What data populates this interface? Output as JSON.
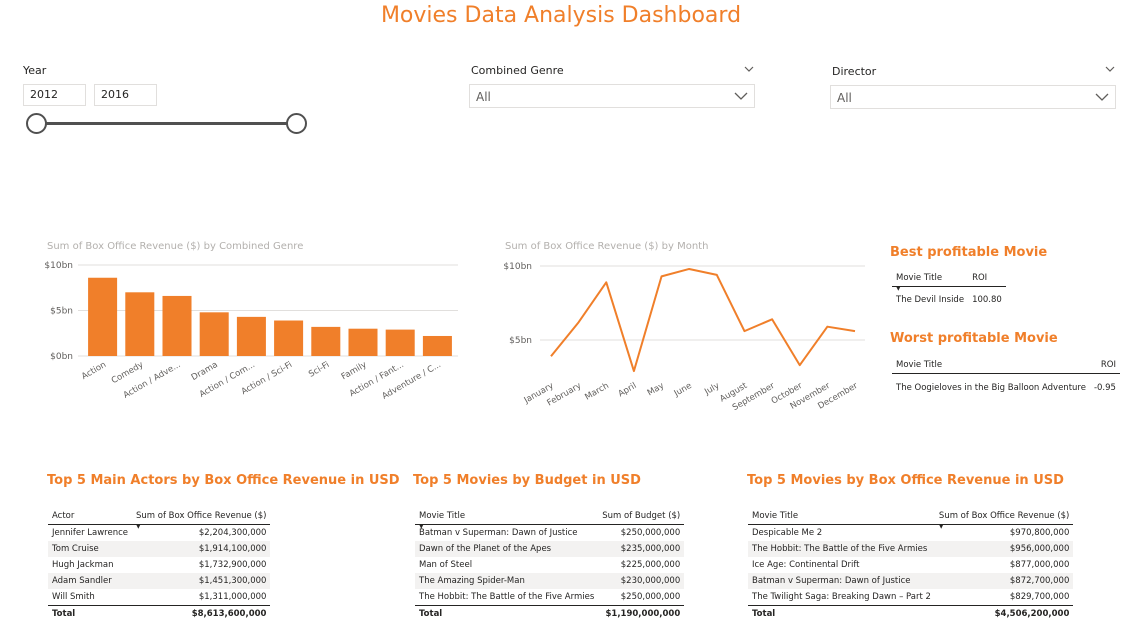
{
  "title": "Movies Data Analysis Dashboard",
  "filters": {
    "year": {
      "label": "Year",
      "start": "2012",
      "end": "2016"
    },
    "genre": {
      "label": "Combined Genre",
      "value": "All"
    },
    "director": {
      "label": "Director",
      "value": "All"
    }
  },
  "colors": {
    "accent": "#f07f2a",
    "grid": "#e1dfdd",
    "axis_text": "#605e5c",
    "title_gray": "#b3b0ad"
  },
  "genre_chart": {
    "title": "Sum of Box Office Revenue ($) by Combined Genre",
    "chart_data": {
      "type": "bar",
      "title": "Sum of Box Office Revenue ($) by Combined Genre",
      "categories": [
        "Action",
        "Comedy",
        "Action / Adve...",
        "Drama",
        "Action / Com...",
        "Action / Sci-Fi",
        "Sci-Fi",
        "Family",
        "Action / Fant...",
        "Adventure / C..."
      ],
      "values": [
        8.6,
        7.0,
        6.6,
        4.8,
        4.3,
        3.9,
        3.2,
        3.0,
        2.9,
        2.2
      ],
      "unit": "bn",
      "yticks": [
        "$0bn",
        "$5bn",
        "$10bn"
      ],
      "ylim": [
        0,
        10
      ],
      "grid": true
    }
  },
  "month_chart": {
    "title": "Sum of Box Office Revenue ($) by Month",
    "chart_data": {
      "type": "line",
      "title": "Sum of Box Office Revenue ($) by Month",
      "categories": [
        "January",
        "February",
        "March",
        "April",
        "May",
        "June",
        "July",
        "August",
        "September",
        "October",
        "November",
        "December"
      ],
      "values": [
        3.9,
        6.2,
        8.9,
        2.9,
        9.3,
        9.8,
        9.4,
        5.6,
        6.4,
        3.3,
        5.9,
        5.6
      ],
      "unit": "bn",
      "yticks": [
        "$5bn",
        "$10bn"
      ],
      "ylim": [
        2.2,
        10.0
      ],
      "grid": true
    }
  },
  "best_movie": {
    "title": "Best profitable Movie",
    "headers": [
      "Movie Title",
      "ROI"
    ],
    "row": [
      "The Devil Inside",
      "100.80"
    ]
  },
  "worst_movie": {
    "title": "Worst profitable Movie",
    "headers": [
      "Movie Title",
      "ROI"
    ],
    "row": [
      "The Oogieloves in the Big Balloon Adventure",
      "-0.95"
    ]
  },
  "actors": {
    "title": "Top 5 Main Actors by Box Office Revenue in USD",
    "headers": [
      "Actor",
      "Sum of Box Office Revenue ($)"
    ],
    "rows": [
      [
        "Jennifer Lawrence",
        "$2,204,300,000"
      ],
      [
        "Tom Cruise",
        "$1,914,100,000"
      ],
      [
        "Hugh Jackman",
        "$1,732,900,000"
      ],
      [
        "Adam Sandler",
        "$1,451,300,000"
      ],
      [
        "Will Smith",
        "$1,311,000,000"
      ]
    ],
    "total": [
      "Total",
      "$8,613,600,000"
    ]
  },
  "budget": {
    "title": "Top 5 Movies by Budget in USD",
    "headers": [
      "Movie Title",
      "Sum of Budget ($)"
    ],
    "rows": [
      [
        "Batman v Superman: Dawn of Justice",
        "$250,000,000"
      ],
      [
        "Dawn of the Planet of the Apes",
        "$235,000,000"
      ],
      [
        "Man of Steel",
        "$225,000,000"
      ],
      [
        "The Amazing Spider-Man",
        "$230,000,000"
      ],
      [
        "The Hobbit: The Battle of the Five Armies",
        "$250,000,000"
      ]
    ],
    "total": [
      "Total",
      "$1,190,000,000"
    ]
  },
  "revenue": {
    "title": "Top 5 Movies by Box Office Revenue in USD",
    "headers": [
      "Movie Title",
      "Sum of Box Office Revenue ($)"
    ],
    "rows": [
      [
        "Despicable Me 2",
        "$970,800,000"
      ],
      [
        "The Hobbit: The Battle of the Five Armies",
        "$956,000,000"
      ],
      [
        "Ice Age: Continental Drift",
        "$877,000,000"
      ],
      [
        "Batman v Superman: Dawn of Justice",
        "$872,700,000"
      ],
      [
        "The Twilight Saga: Breaking Dawn – Part 2",
        "$829,700,000"
      ]
    ],
    "total": [
      "Total",
      "$4,506,200,000"
    ]
  }
}
